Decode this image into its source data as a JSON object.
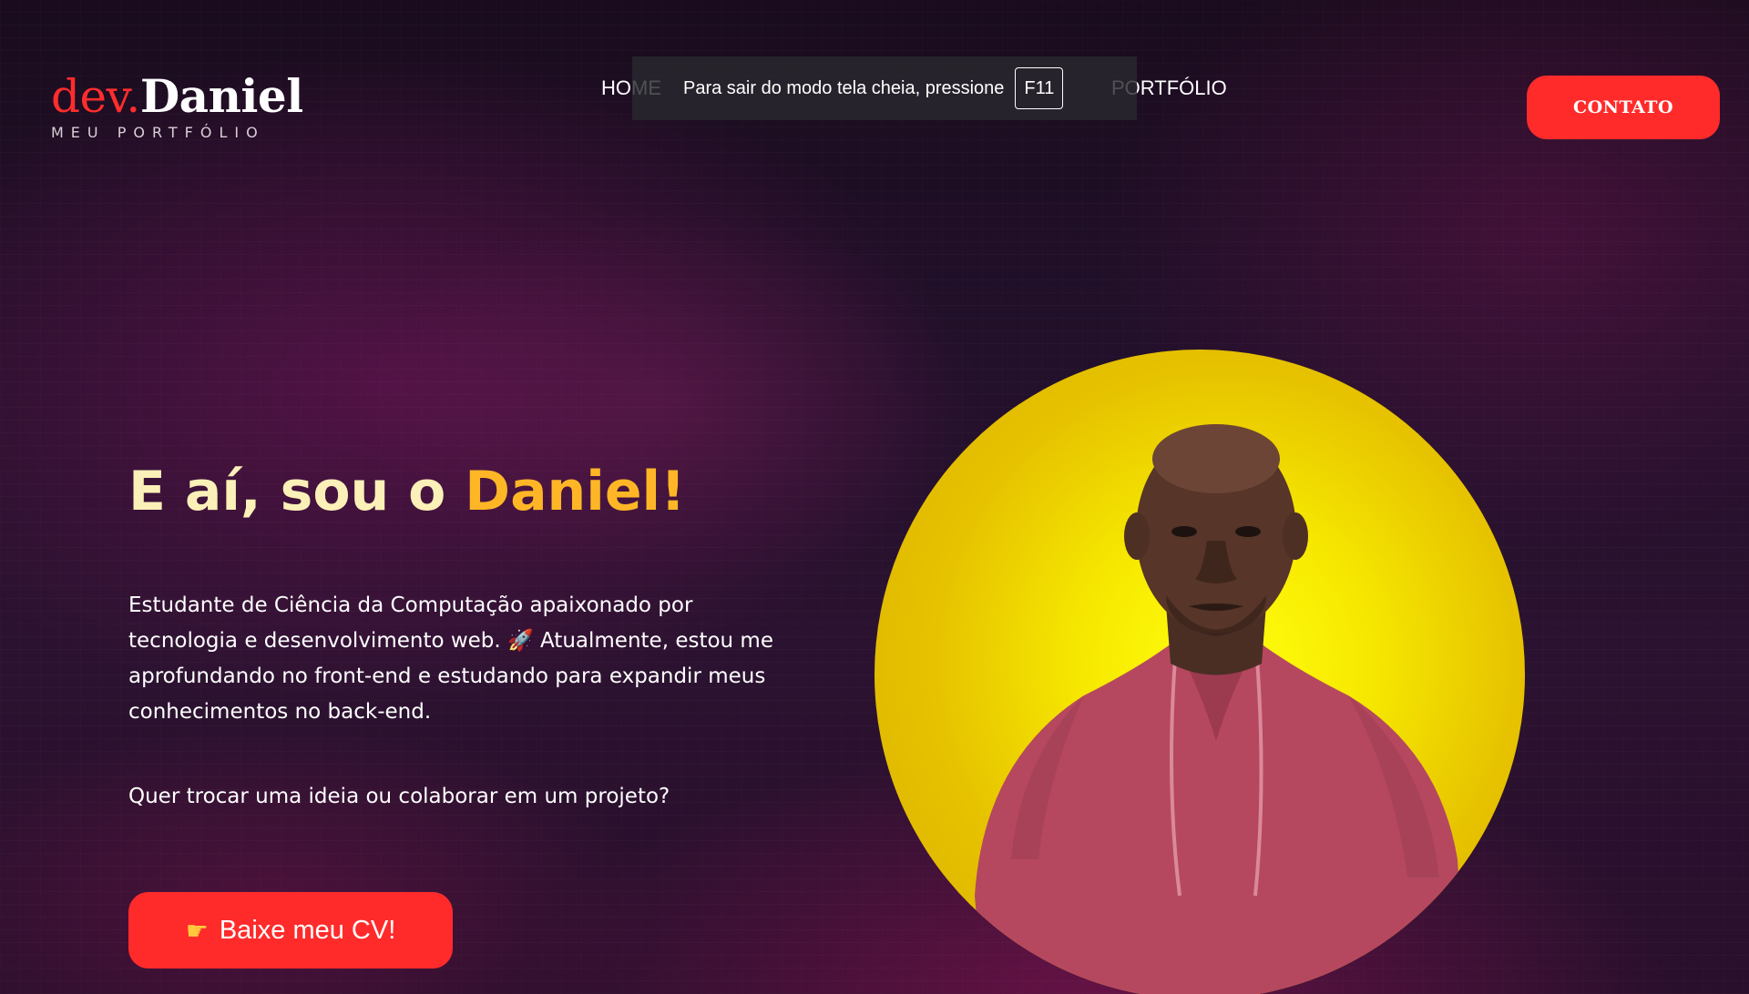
{
  "logo": {
    "prefix": "dev.",
    "name": "Daniel",
    "subtitle": "MEU PORTFÓLIO"
  },
  "nav": {
    "home": "HOME",
    "portfolio": "PORTFÓLIO"
  },
  "toast": {
    "message": "Para sair do modo tela cheia, pressione",
    "key": "F11"
  },
  "contact_button": "CONTATO",
  "hero": {
    "title_prefix": "E aí, sou o ",
    "title_name": "Daniel!",
    "description": "Estudante de Ciência da Computação apaixonado por tecnologia e desenvolvimento web. 🚀 Atualmente, estou me aprofundando no front-end e estudando para expandir meus conhecimentos no back-end.",
    "question": "Quer trocar uma ideia ou colaborar em um projeto?",
    "cv_button": "Baixe meu CV!",
    "cv_icon": "pointing-hand-icon"
  },
  "colors": {
    "accent_red": "#ff2b2b",
    "title_cream": "#fbf0b8",
    "title_accent": "#ffb626",
    "profile_yellow": "#f7ea00",
    "background": "#1f0e24"
  }
}
